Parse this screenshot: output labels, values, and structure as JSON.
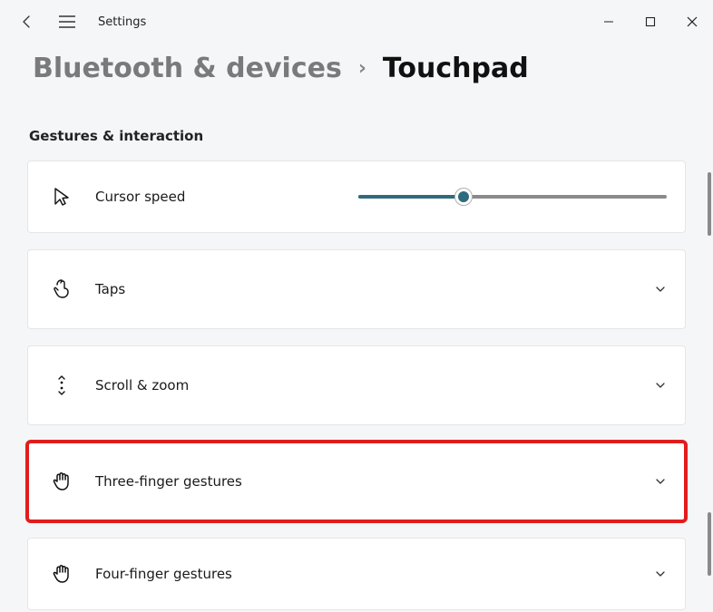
{
  "app": {
    "title": "Settings"
  },
  "breadcrumb": {
    "parent": "Bluetooth & devices",
    "separator": "›",
    "current": "Touchpad"
  },
  "section": {
    "title": "Gestures & interaction",
    "cursor_speed": {
      "label": "Cursor speed",
      "value_percent": 34
    },
    "taps": {
      "label": "Taps"
    },
    "scroll_zoom": {
      "label": "Scroll & zoom"
    },
    "three_finger": {
      "label": "Three-finger gestures"
    },
    "four_finger": {
      "label": "Four-finger gestures"
    }
  }
}
